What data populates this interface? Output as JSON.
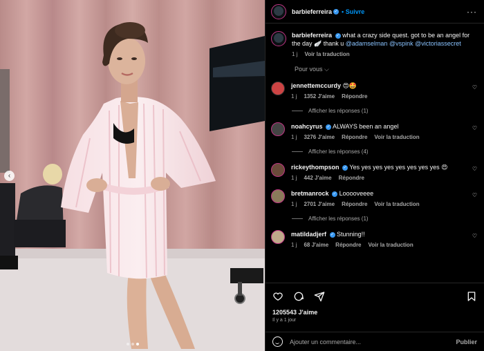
{
  "header": {
    "username": "barbieferreira",
    "follow_label": "Suivre",
    "more_icon": "more-horizontal-icon"
  },
  "caption": {
    "username": "barbieferreira",
    "text_1": "what a crazy side quest. got to be an angel for the day 🪽 thank u ",
    "mention_1": "@adamselman",
    "mention_2": "@vspink",
    "mention_3": "@victoriassecret",
    "time": "1 j",
    "translate": "Voir la traduction"
  },
  "sort_label": "Pour vous",
  "comments": [
    {
      "user": "jennettemccurdy",
      "text": "😍🤩",
      "time": "1 j",
      "likes": "1352 J'aime",
      "reply": "Répondre",
      "translate": "",
      "replies": "Afficher les réponses (1)"
    },
    {
      "user": "noahcyrus",
      "text": "ALWAYS been an angel",
      "time": "1 j",
      "likes": "3276 J'aime",
      "reply": "Répondre",
      "translate": "Voir la traduction",
      "replies": "Afficher les réponses (4)"
    },
    {
      "user": "rickeythompson",
      "text": "Yes yes yes yes yes yes yes yes 😍",
      "time": "1 j",
      "likes": "442 J'aime",
      "reply": "Répondre",
      "translate": "",
      "replies": ""
    },
    {
      "user": "bretmanrock",
      "text": "Looooveeee",
      "time": "1 j",
      "likes": "2701 J'aime",
      "reply": "Répondre",
      "translate": "Voir la traduction",
      "replies": "Afficher les réponses (1)"
    },
    {
      "user": "matildadjerf",
      "text": "Stunning!!",
      "time": "1 j",
      "likes": "68 J'aime",
      "reply": "Répondre",
      "translate": "Voir la traduction",
      "replies": ""
    }
  ],
  "footer": {
    "likes": "1205543 J'aime",
    "date": "Il y a 1 jour",
    "comment_placeholder": "Ajouter un commentaire...",
    "publish_label": "Publier"
  },
  "colors": {
    "accent": "#0095f6",
    "verified": "#3797f0",
    "background": "#000000"
  }
}
